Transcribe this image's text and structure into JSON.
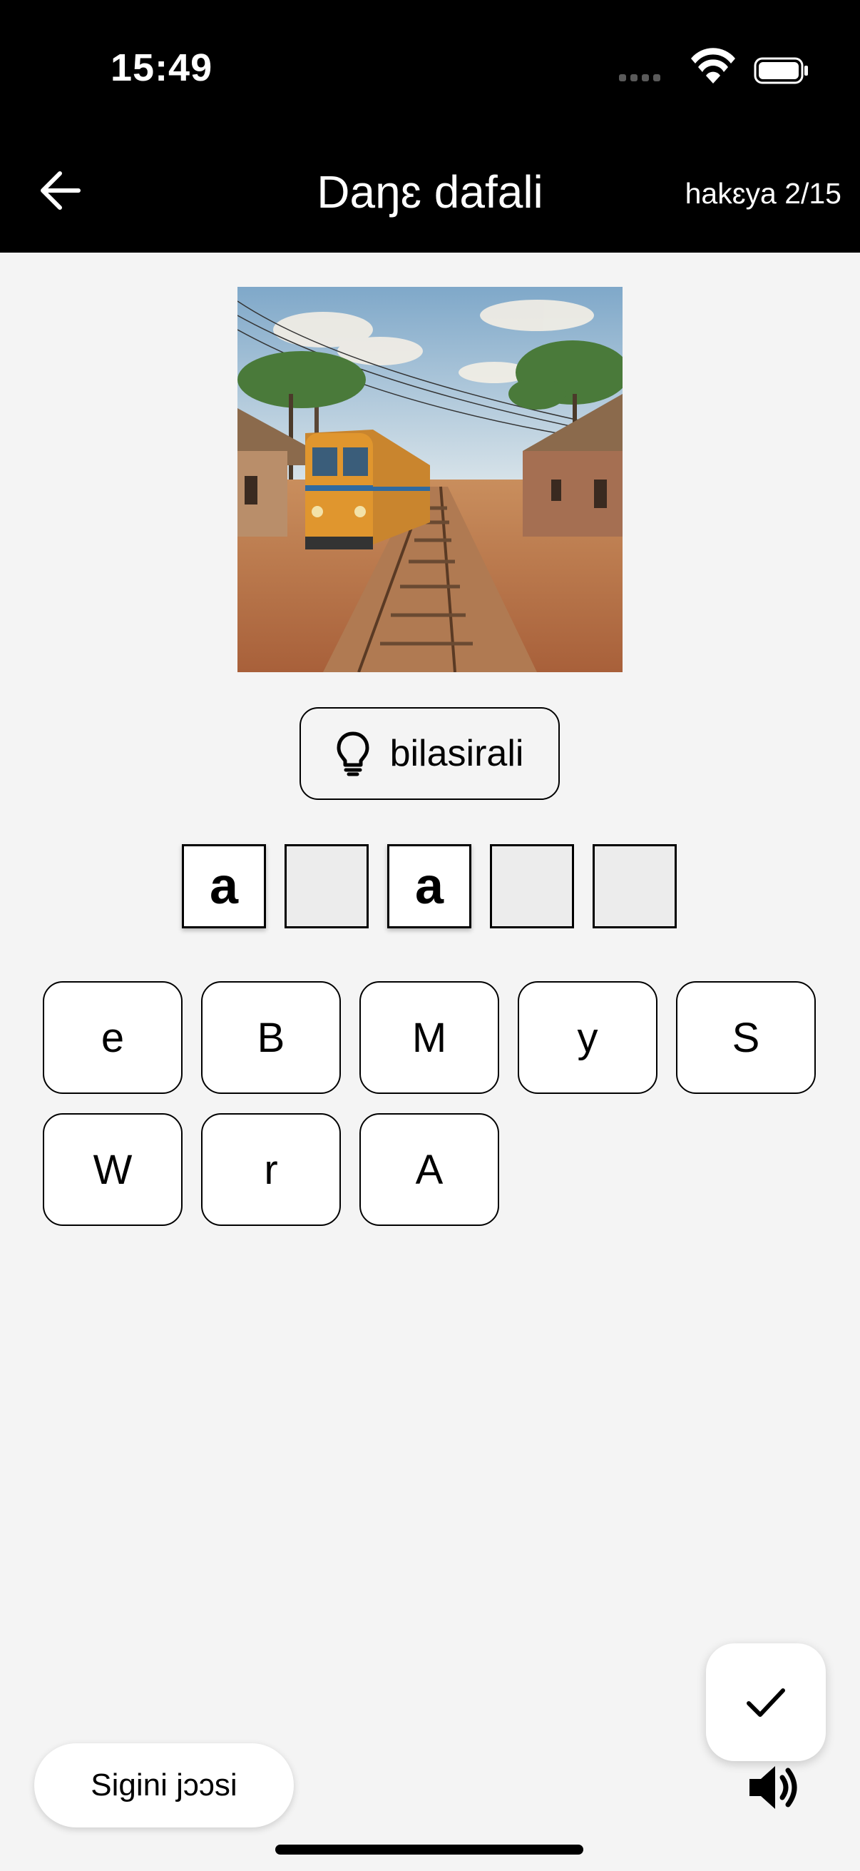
{
  "status_bar": {
    "time": "15:49"
  },
  "app_bar": {
    "back_icon": "arrow-left-icon",
    "title": "Daŋɛ dafali",
    "progress": "hakɛya 2/15"
  },
  "picture": {
    "subject": "train on railway tracks through a village street"
  },
  "hint": {
    "icon": "lightbulb-icon",
    "label": "bilasirali"
  },
  "answer_slots": [
    {
      "letter": "a",
      "state": "filled"
    },
    {
      "letter": "",
      "state": "empty"
    },
    {
      "letter": "a",
      "state": "filled"
    },
    {
      "letter": "",
      "state": "empty"
    },
    {
      "letter": "",
      "state": "empty"
    }
  ],
  "letter_keys": [
    "e",
    "B",
    "M",
    "y",
    "S",
    "W",
    "r",
    "A"
  ],
  "fab": {
    "icon": "check-icon"
  },
  "signin_button": {
    "label": "Sigini jɔɔsi"
  },
  "sound": {
    "icon": "speaker-icon"
  },
  "colors": {
    "app_bar": "#000000",
    "background": "#f4f4f4",
    "key_background": "#ffffff",
    "empty_slot": "#ececec"
  }
}
